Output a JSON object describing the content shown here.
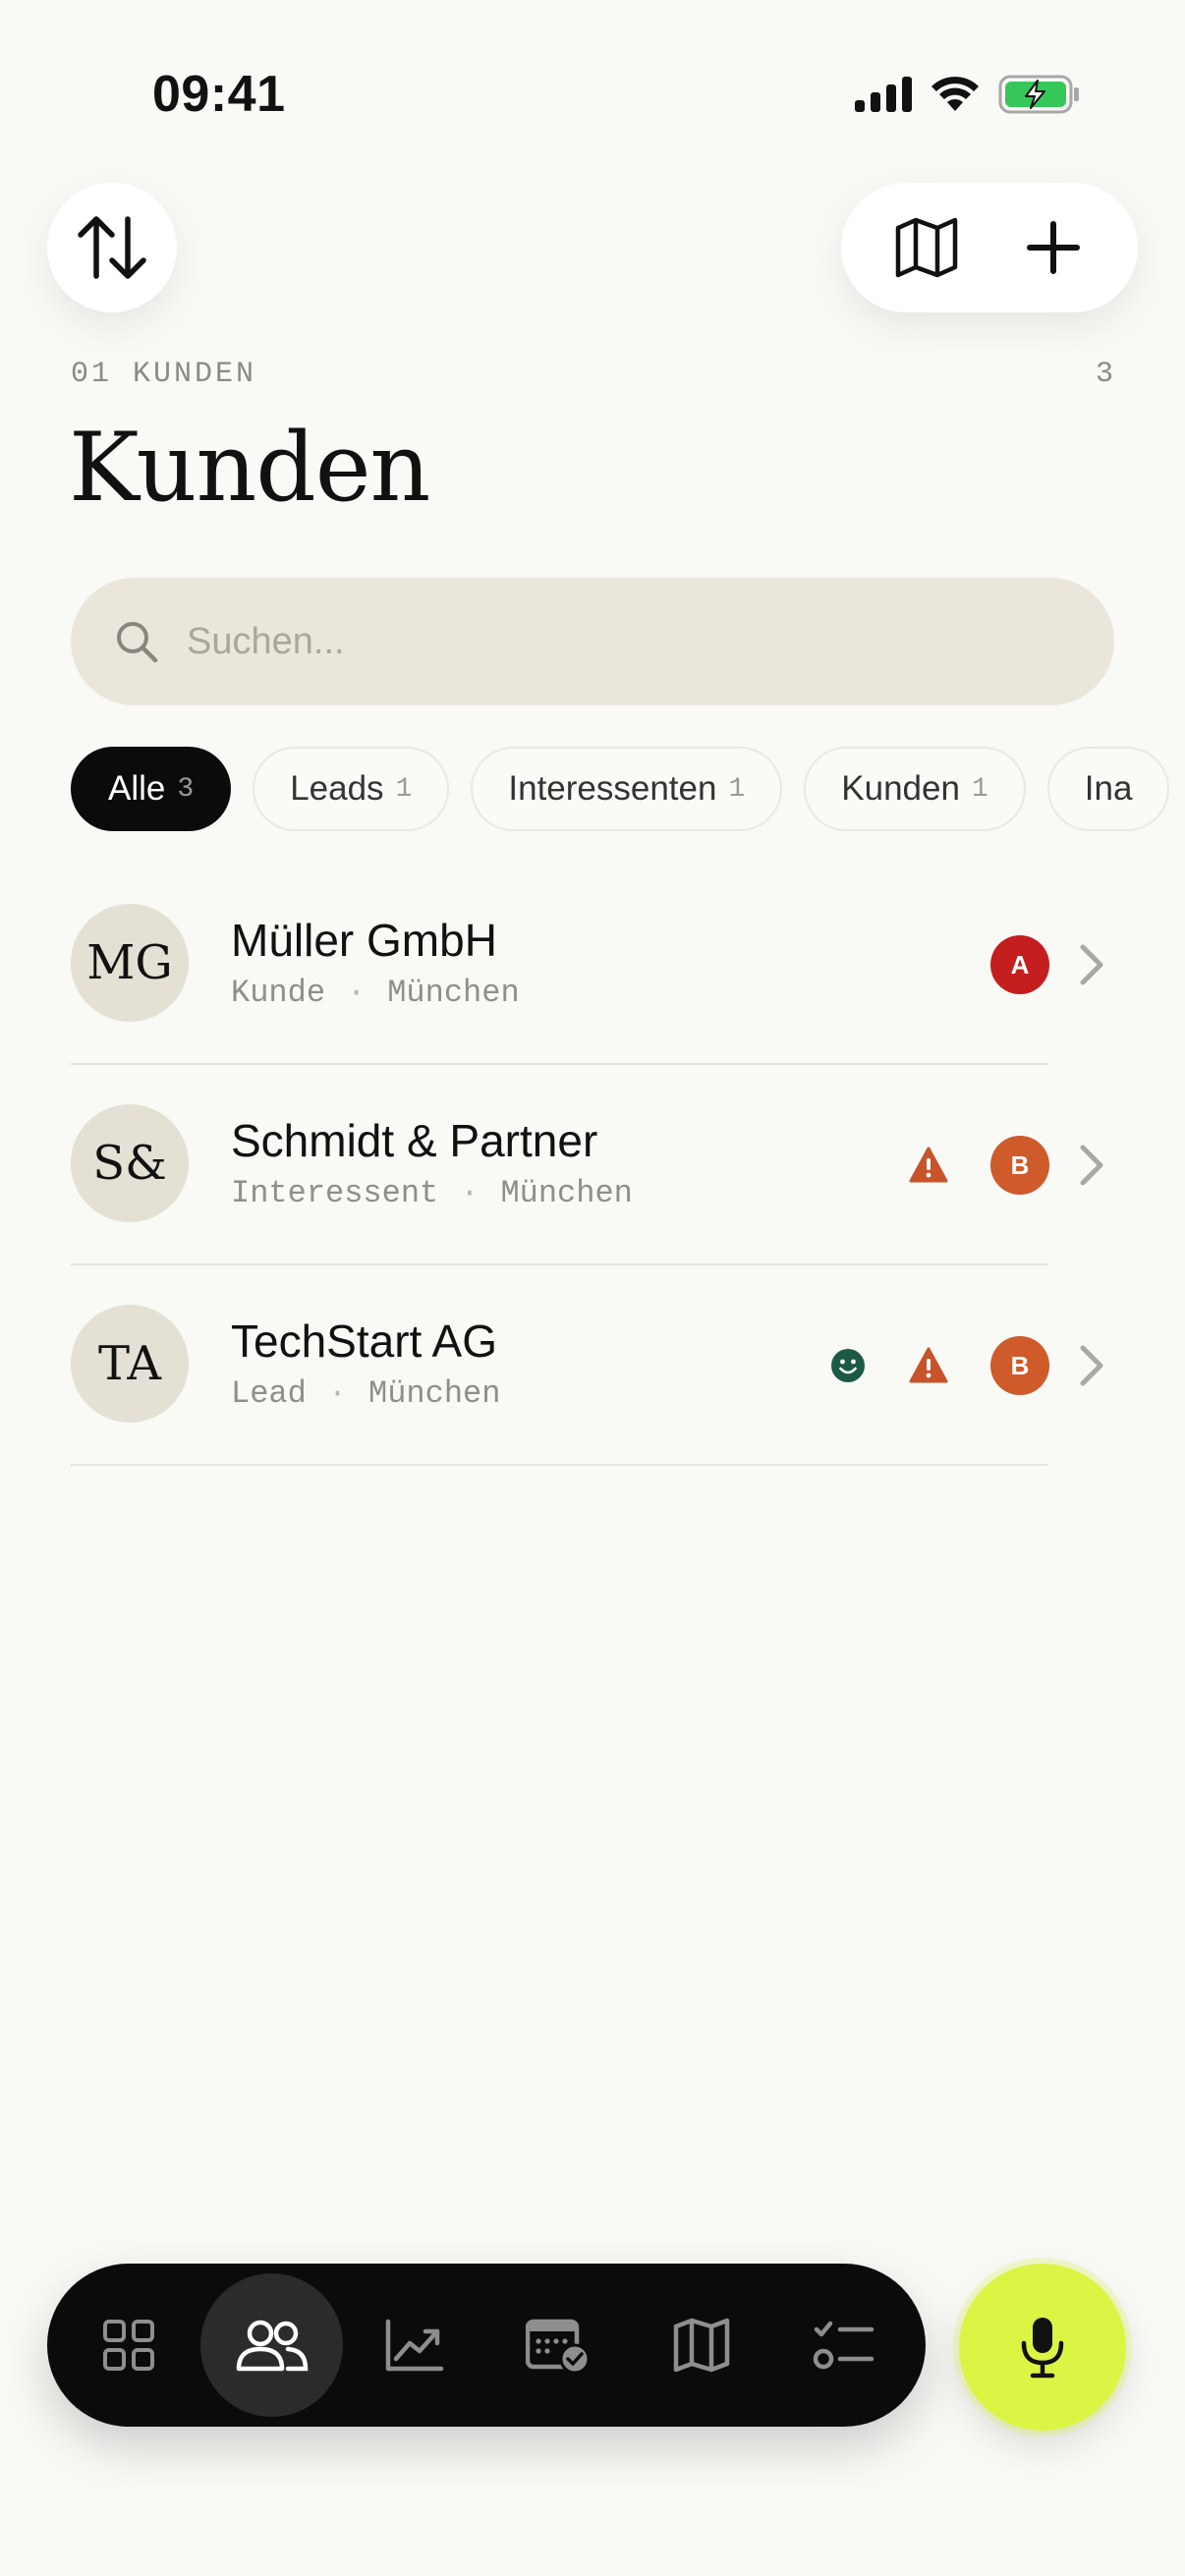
{
  "status_bar": {
    "time": "09:41"
  },
  "header": {
    "eyebrow": "01 KUNDEN",
    "count": "3",
    "title": "Kunden"
  },
  "search": {
    "placeholder": "Suchen...",
    "value": ""
  },
  "filters": [
    {
      "label": "Alle",
      "count": "3",
      "active": true
    },
    {
      "label": "Leads",
      "count": "1",
      "active": false
    },
    {
      "label": "Interessenten",
      "count": "1",
      "active": false
    },
    {
      "label": "Kunden",
      "count": "1",
      "active": false
    },
    {
      "label": "Ina",
      "count": "",
      "active": false
    }
  ],
  "customers": [
    {
      "initials": "MG",
      "name": "Müller GmbH",
      "type": "Kunde",
      "city": "München",
      "priority": "A",
      "priority_color": "#c41e1e",
      "warning": false,
      "smile": false
    },
    {
      "initials": "S&",
      "name": "Schmidt & Partner",
      "type": "Interessent",
      "city": "München",
      "priority": "B",
      "priority_color": "#cf5a2a",
      "warning": true,
      "smile": false
    },
    {
      "initials": "TA",
      "name": "TechStart AG",
      "type": "Lead",
      "city": "München",
      "priority": "B",
      "priority_color": "#cf5a2a",
      "warning": true,
      "smile": true
    }
  ],
  "colors": {
    "background": "#f9f9f6",
    "accent_mic": "#dcf545",
    "warning": "#c8532a",
    "smile": "#1d5a43",
    "tabbar": "#0b0b0b"
  },
  "nav": {
    "tabs": [
      {
        "icon": "grid-icon",
        "active": false
      },
      {
        "icon": "people-icon",
        "active": true
      },
      {
        "icon": "chart-icon",
        "active": false
      },
      {
        "icon": "calendar-check-icon",
        "active": false
      },
      {
        "icon": "map-icon",
        "active": false
      },
      {
        "icon": "checklist-icon",
        "active": false
      }
    ]
  }
}
